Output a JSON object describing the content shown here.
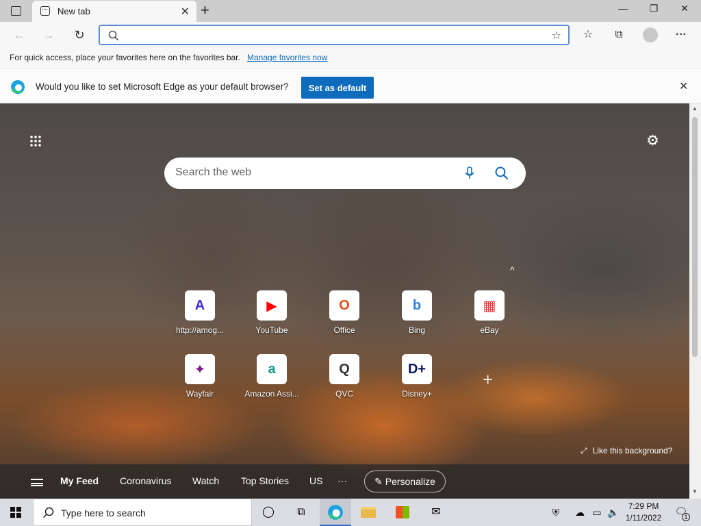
{
  "browser": {
    "tab": {
      "title": "New tab",
      "close": "✕"
    },
    "new_tab": "+",
    "window": {
      "minimize": "—",
      "restore": "❐",
      "close": "✕"
    },
    "address": {
      "value": "",
      "placeholder": ""
    }
  },
  "favorites_bar": {
    "text": "For quick access, place your favorites here on the favorites bar.",
    "link": "Manage favorites now"
  },
  "infobar": {
    "message": "Would you like to set Microsoft Edge as your default browser?",
    "button": "Set as default"
  },
  "newtab": {
    "search_placeholder": "Search the web",
    "collapse": "^",
    "tiles": [
      {
        "label": "http://amog...",
        "icon": "A",
        "color": "#3b2dd6"
      },
      {
        "label": "YouTube",
        "icon": "▶",
        "color": "#ff0000"
      },
      {
        "label": "Office",
        "icon": "O",
        "color": "#e74c1c"
      },
      {
        "label": "Bing",
        "icon": "b",
        "color": "#2b7de0"
      },
      {
        "label": "eBay",
        "icon": "▦",
        "color": "#e53238"
      },
      {
        "label": "Wayfair",
        "icon": "✦",
        "color": "#7f187f"
      },
      {
        "label": "Amazon Assi...",
        "icon": "a",
        "color": "#1a9a8c"
      },
      {
        "label": "QVC",
        "icon": "Q",
        "color": "#333333"
      },
      {
        "label": "Disney+",
        "icon": "D+",
        "color": "#0b1a5c"
      }
    ],
    "add_tile": "+",
    "like_background": "Like this background?",
    "feed": {
      "items": [
        "My Feed",
        "Coronavirus",
        "Watch",
        "Top Stories",
        "US"
      ],
      "more": "···",
      "personalize": "Personalize"
    }
  },
  "taskbar": {
    "search_text": "Type here to search",
    "time": "7:29 PM",
    "date": "1/11/2022",
    "notification_count": "1"
  }
}
